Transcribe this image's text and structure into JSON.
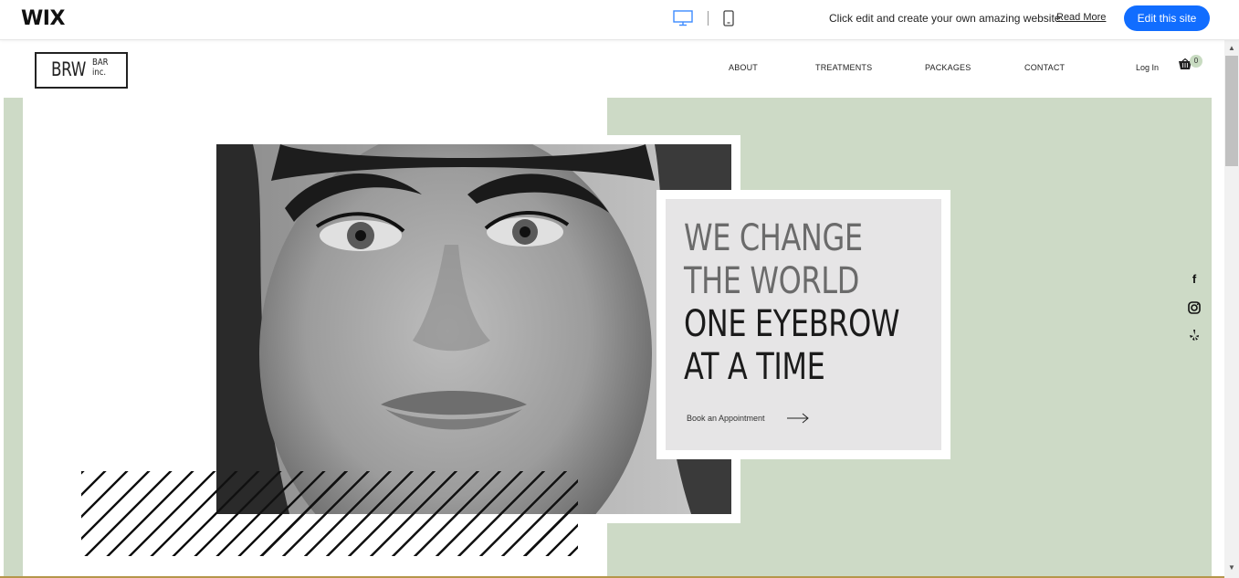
{
  "wixbar": {
    "logo": "WIX",
    "message": "Click edit and create your own amazing website",
    "read_more": "Read More",
    "edit_button": "Edit this site",
    "desktop_icon": "desktop-icon",
    "mobile_icon": "mobile-icon"
  },
  "header": {
    "logo_main": "BRW",
    "logo_bar": "BAR",
    "logo_inc": "inc.",
    "nav": [
      "ABOUT",
      "TREATMENTS",
      "PACKAGES",
      "CONTACT"
    ],
    "login": "Log In",
    "cart_count": "0"
  },
  "hero": {
    "line1": "WE CHANGE",
    "line2": "THE WORLD",
    "line3": "ONE EYEBROW",
    "line4": "AT A TIME",
    "cta": "Book an Appointment"
  },
  "social": [
    "facebook-icon",
    "instagram-icon",
    "yelp-icon"
  ],
  "colors": {
    "wix_blue": "#116dff",
    "sage": "#cddac6",
    "card_gray": "#e6e5e6",
    "headline_gray": "#6b6b6b",
    "headline_dark": "#1b1b1b"
  }
}
